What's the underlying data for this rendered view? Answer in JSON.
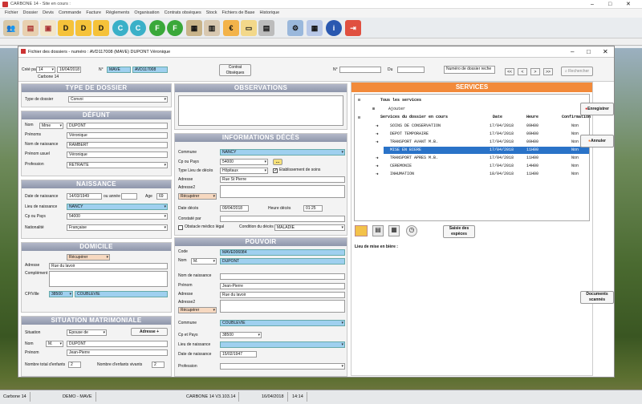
{
  "app": {
    "title": "CARBONE 14 - Site en cours :",
    "subtitle": "Fichier des dossiers - numéro : AVD117008 (MAVE) DUPONT Véronique"
  },
  "menu": [
    "Fichier",
    "Dossier",
    "Devis",
    "Commande",
    "Facture",
    "Règlements",
    "Organisation",
    "Contrats obsèques",
    "Stock",
    "Fichiers de Base",
    "Historique"
  ],
  "toolbar": {
    "letters": [
      "D",
      "D",
      "D",
      "C",
      "C",
      "F",
      "F"
    ]
  },
  "top": {
    "cree_par_label": "Créé par",
    "cree_par": "14",
    "date": "16/04/2018",
    "site": "Carbone 14",
    "n_label": "N°",
    "n_value": "MAVE",
    "n_value2": "AVD117008",
    "contrat_btn": "Contrat Obsèques",
    "num_label": "N°",
    "du_label": "Du",
    "search_placeholder": "Numéro de dossier reche",
    "rechercher": "Rechercher",
    "nav": [
      "<<",
      "<",
      ">",
      ">>"
    ]
  },
  "type_dossier": {
    "header": "TYPE DE DOSSIER",
    "label": "Type de dossier",
    "value": "Convoi"
  },
  "defunt": {
    "header": "DÉFUNT",
    "nom_label": "Nom",
    "civ": "Mme",
    "nom": "DUPONT",
    "prenoms_label": "Prénoms",
    "prenoms": "Véronique",
    "nom_naissance_label": "Nom de naissance",
    "nom_naissance": "RAMBERT",
    "prenom_usuel_label": "Prénom usuel",
    "prenom_usuel": "Véronique",
    "profession_label": "Profession",
    "profession": "RETRAITE"
  },
  "naissance": {
    "header": "NAISSANCE",
    "date_label": "Date de naissance",
    "date": "14/03/1949",
    "ou_annee": "ou année",
    "age_label": "Age",
    "age": "69",
    "lieu_label": "Lieu de naissance",
    "lieu": "NANCY",
    "cp_label": "Cp ou Pays",
    "cp": "54000",
    "nat_label": "Nationalité",
    "nat": "Française"
  },
  "domicile": {
    "header": "DOMICILE",
    "recuperer": "Récupérer",
    "adresse_label": "Adresse",
    "adresse": "Rue du lavoir",
    "complement_label": "Complément",
    "cpville_label": "CP/Ville",
    "cp": "38500",
    "ville": "COUBLEVIE"
  },
  "situation": {
    "header": "SITUATION MATRIMONIALE",
    "situation_label": "Situation",
    "situation": "Épouse de",
    "adresse_btn": "Adresse +",
    "nom_label": "Nom",
    "civ": "M.",
    "nom": "DUPONT",
    "prenom_label": "Prénom",
    "prenom": "Jean-Pierre",
    "enfants_label": "Nombre total d'enfants",
    "enfants": "2",
    "vivants_label": "Nombre d'enfants vivants",
    "vivants": "2"
  },
  "observations": {
    "header": "OBSERVATIONS"
  },
  "deces": {
    "header": "INFORMATIONS DÉCÈS",
    "commune_label": "Commune",
    "commune": "NANCY",
    "cp_label": "Cp ou Pays",
    "cp": "54000",
    "type_label": "Type Lieu de décès",
    "type": "Hôpitaux",
    "etab_label": "Etablissement de soins",
    "adresse_label": "Adresse",
    "adresse": "Rue St Pierre",
    "adresse2_label": "Adresse2",
    "recuperer": "Récupérer",
    "date_label": "Date décès",
    "date": "09/04/2018",
    "heure_label": "Heure décès",
    "heure": "01:25",
    "constat_label": "Constaté par",
    "obstacle_label": "Obstacle médico légal",
    "condition_label": "Condition du décès",
    "condition": "MALADIE"
  },
  "pouvoir": {
    "header": "POUVOIR",
    "code_label": "Code",
    "code": "MAVE006084",
    "nom_label": "Nom",
    "civ": "M.",
    "nom": "DUPONT",
    "nom_naissance_label": "Nom de naissance",
    "prenom_label": "Prénom",
    "prenom": "Jean-Pierre",
    "adresse_label": "Adresse",
    "adresse": "Rue du lavoir",
    "adresse2_label": "Adresse2",
    "recuperer": "Récupérer",
    "commune_label": "Commune",
    "commune": "COUBLEVIE",
    "cp_label": "Cp et Pays",
    "cp": "38500",
    "lieu_label": "Lieu de naissance",
    "date_label": "Date de naissance",
    "date": "15/02/1947",
    "profession_label": "Profession"
  },
  "services": {
    "header": "SERVICES",
    "tous": "Tous les services",
    "ajouter": "Ajouter",
    "col_services": "Services du dossier en cours",
    "col_date": "Date",
    "col_heure": "Heure",
    "col_conf": "Confirmation",
    "rows": [
      {
        "name": "SOINS DE CONSERVATION",
        "date": "17/04/2018",
        "heure": "09H00",
        "conf": "Non"
      },
      {
        "name": "DEPOT TEMPORAIRE",
        "date": "17/04/2018",
        "heure": "09H00",
        "conf": "Non"
      },
      {
        "name": "TRANSPORT AVANT M.B.",
        "date": "17/04/2018",
        "heure": "09H00",
        "conf": "Non"
      },
      {
        "name": "MISE EN BIERE",
        "date": "17/04/2018",
        "heure": "11H00",
        "conf": "Non"
      },
      {
        "name": "TRANSPORT APRES M.B.",
        "date": "17/04/2018",
        "heure": "11H00",
        "conf": "Non"
      },
      {
        "name": "CEREMONIE",
        "date": "17/04/2018",
        "heure": "14H00",
        "conf": "Non"
      },
      {
        "name": "INHUMATION",
        "date": "18/04/2018",
        "heure": "11H00",
        "conf": "Non"
      }
    ],
    "saisie_btn": "Saisie des espèces",
    "lieu_label": "Lieu de mise en bière :"
  },
  "actions": {
    "enregistrer": "Enregistrer",
    "annuler": "Annuler",
    "documents": "Documents scannés"
  },
  "taskbar": {
    "app": "Carbone 14",
    "user": "DEMO - MAVE",
    "version": "CARBONE 14 V3.103.14",
    "date": "16/04/2018",
    "time": "14:14"
  }
}
